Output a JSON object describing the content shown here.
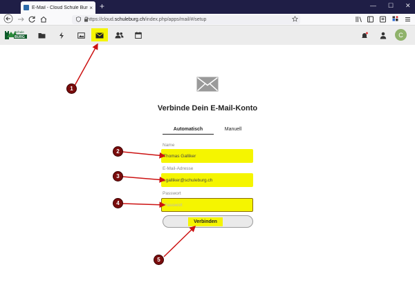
{
  "browser": {
    "tab_title": "E-Mail - Cloud Schule Burg",
    "tab_close": "×",
    "new_tab": "+",
    "url_prefix": "https://cloud.",
    "url_domain": "schuleburg.ch",
    "url_path": "/index.php/apps/mail/#/setup",
    "window_controls": [
      "—",
      "☐",
      "✕"
    ],
    "nav_icons": [
      "arrow-left-icon",
      "arrow-right-icon",
      "reload-icon",
      "home-icon"
    ],
    "toolbar_icons": [
      "library-icon",
      "sidebar-icon",
      "reader-icon",
      "extensions-icon",
      "menu-icon"
    ]
  },
  "app": {
    "logo_top": "Schule",
    "logo_bottom": "BURG",
    "nav_icons": [
      "folder-icon",
      "activity-icon",
      "image-icon",
      "mail-icon",
      "contacts-icon",
      "calendar-icon"
    ],
    "active": "mail-icon",
    "user_initial": "C",
    "colors": {
      "header": "#ececec",
      "highlight": "#f5f500",
      "avatar": "#8fb26b",
      "badge": "#7a0c0c",
      "arrow": "#cc1111"
    }
  },
  "setup": {
    "heading": "Verbinde Dein E-Mail-Konto",
    "tab_auto": "Automatisch",
    "tab_manual": "Manuell",
    "name_label": "Name",
    "name_value": "Thomas Galliker",
    "email_label": "E-Mail-Adresse",
    "email_value": "t.galliker@schuleburg.ch",
    "password_label": "Passwort",
    "password_placeholder": "Passwort",
    "connect_button": "Verbinden"
  },
  "annotations": [
    "1",
    "2",
    "3",
    "4",
    "5"
  ]
}
